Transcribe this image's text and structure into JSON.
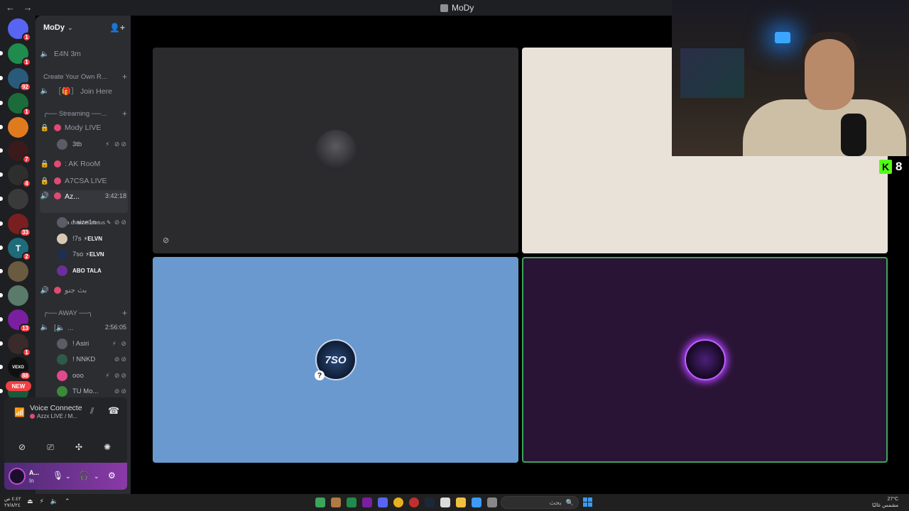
{
  "titlebar": {
    "title": "MoDy",
    "nav": "← →"
  },
  "rail": {
    "servers": [
      {
        "icon": "discord-home-icon",
        "badge": "1",
        "color": "#5865f2"
      },
      {
        "icon": "server-icon",
        "badge": "1",
        "color": "#1f8b4c"
      },
      {
        "icon": "server-icon",
        "badge": "92",
        "color": "#2a5a7a"
      },
      {
        "icon": "server-icon",
        "badge": "1",
        "color": "#1c6b3a"
      },
      {
        "icon": "server-icon",
        "badge": "",
        "color": "#e07a1f"
      },
      {
        "icon": "server-icon",
        "badge": "7",
        "color": "#3a1a1a"
      },
      {
        "icon": "server-icon",
        "badge": "4",
        "color": "#2e2e2e"
      },
      {
        "icon": "server-icon",
        "badge": "",
        "color": "#3a3a3a"
      },
      {
        "icon": "server-icon",
        "badge": "33",
        "color": "#7a1f1f"
      },
      {
        "icon": "server-icon",
        "badge": "2",
        "color": "#1e6b7a"
      },
      {
        "icon": "server-icon",
        "badge": "",
        "color": "#6a5a40"
      },
      {
        "icon": "server-icon",
        "badge": "",
        "color": "#5a7a6a"
      },
      {
        "icon": "server-icon",
        "badge": "13",
        "color": "#7a1fa0"
      },
      {
        "icon": "server-icon",
        "badge": "1",
        "color": "#3a2a2a"
      },
      {
        "icon": "server-icon",
        "badge": "88",
        "color": "#101010"
      },
      {
        "icon": "server-icon",
        "badge": "",
        "color": "#1a5a3a"
      }
    ],
    "server_labels": {
      "t_server": "T",
      "vexo": "VEXO"
    },
    "new_label": "NEW"
  },
  "sidebar": {
    "server_name": "MoDy",
    "channels": {
      "e4n": "E4N 3m",
      "create_cat": "Create Your Own R...",
      "join_here": "［🎁］ Join Here",
      "streaming_cat": "╭── Streaming ──...",
      "mody_live": "Mody LIVE",
      "ak_room": ": AK RooM",
      "a7csa_live": "A7CSA LIVE",
      "azzx": "Az...",
      "azzx_time": "3:42:18",
      "status": "Set a channel status ✎",
      "arabic_channel": "بث جنو",
      "away_cat": "╭── AWAY ──╮",
      "away_channel": "[🔈 ...",
      "away_time": "2:56:05"
    },
    "users": {
      "u_3tb": "3tb",
      "u_aize": "! aize1n",
      "u_7s": "!7s",
      "u_7so": "7so",
      "u_abo": "ABO TALA",
      "u_asiri": "! Asiri",
      "u_nnkd": "! NNKD",
      "u_ooo": "ooo",
      "u_tu": "TU Mo...",
      "tag_elvn": "⚡ELVN"
    }
  },
  "voice": {
    "title": "Voice Connecte",
    "subtitle": "Azzx LIVE / M..."
  },
  "user_area": {
    "name": "A...",
    "status": "In"
  },
  "stage": {
    "tile3_avatar_text": "7SO"
  },
  "kick": {
    "count": "8",
    "letter": "K"
  },
  "taskbar": {
    "search_placeholder": "بحث",
    "clock_time": "٤:٤٢ ص",
    "clock_date": "٢٧/٨/٢٤",
    "weather": "27°C",
    "weather_desc": "مشمس غالبًا"
  }
}
